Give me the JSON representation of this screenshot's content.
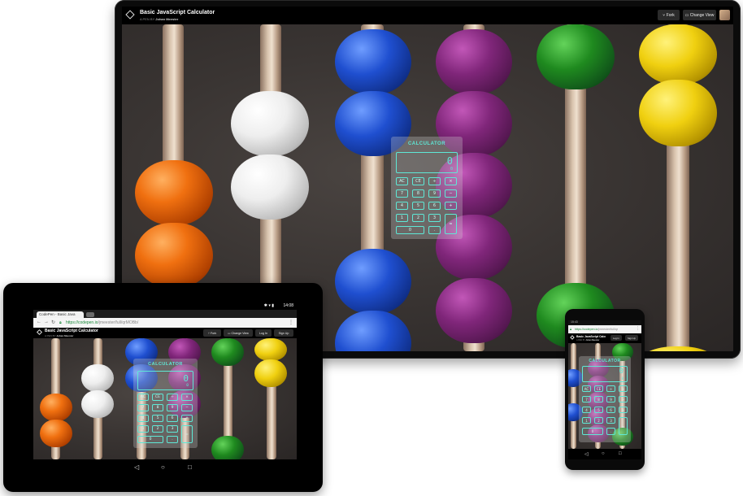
{
  "codepen": {
    "title": "Basic JavaScript Calculator",
    "by_prefix": "A PEN BY",
    "author": "Johan Meester",
    "fork_label": "Fork",
    "change_view_label": "Change View",
    "login_label": "Log In",
    "signup_label": "Sign Up"
  },
  "calculator": {
    "title": "CALCULATOR",
    "display_value": "0",
    "display_sub": "0",
    "keys": [
      "AC",
      "CE",
      "÷",
      "×",
      "7",
      "8",
      "9",
      "−",
      "4",
      "5",
      "6",
      "+",
      "1",
      "2",
      "3",
      "=",
      "0",
      "."
    ]
  },
  "tablet": {
    "time": "14:08",
    "tab_title": "CodePen - Basic Java",
    "url_scheme": "https://",
    "url_host": "codepen.io",
    "url_path": "/jmeester/full/qrMOBb/"
  },
  "phone": {
    "time": "15:43",
    "url_scheme": "https://",
    "url_host": "codepen.io",
    "url_path": "/jmeester/full/qr"
  },
  "icons": [
    "codepen-logo-icon",
    "fork-icon",
    "change-view-icon",
    "back-nav-icon",
    "home-nav-icon",
    "recents-nav-icon",
    "lock-icon",
    "menu-dots-icon"
  ],
  "colors": {
    "calc_accent": "#5ee8d6",
    "url_host": "#1a8a3a",
    "device_frame": "#0b0b0b"
  }
}
